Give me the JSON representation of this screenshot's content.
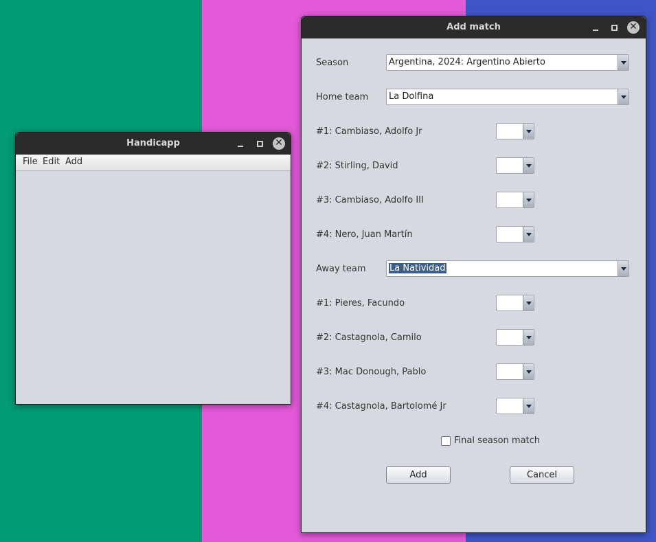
{
  "desktop": {
    "colors": {
      "green": "#029b76",
      "pink": "#e35ad9",
      "blue": "#3f55c6"
    }
  },
  "handicapp": {
    "title": "Handicapp",
    "menu": [
      "File",
      "Edit",
      "Add"
    ],
    "controls": {
      "minimize": "minimize-icon",
      "maximize": "maximize-icon",
      "close": "close-icon"
    }
  },
  "add_match": {
    "title": "Add match",
    "season_label": "Season",
    "season_value": "Argentina, 2024: Argentino Abierto",
    "home_team_label": "Home team",
    "home_team_value": "La Dolfina",
    "home_players": [
      {
        "label": "#1: Cambiaso, Adolfo Jr",
        "value": ""
      },
      {
        "label": "#2: Stirling, David",
        "value": ""
      },
      {
        "label": "#3: Cambiaso, Adolfo III",
        "value": ""
      },
      {
        "label": "#4: Nero, Juan Martín",
        "value": ""
      }
    ],
    "away_team_label": "Away team",
    "away_team_value": "La Natividad",
    "away_players": [
      {
        "label": "#1: Pieres, Facundo",
        "value": ""
      },
      {
        "label": "#2: Castagnola, Camilo",
        "value": ""
      },
      {
        "label": "#3: Mac Donough, Pablo",
        "value": ""
      },
      {
        "label": "#4: Castagnola, Bartolomé Jr",
        "value": ""
      }
    ],
    "final_season_label": "Final season match",
    "final_season_checked": false,
    "add_label": "Add",
    "cancel_label": "Cancel"
  }
}
